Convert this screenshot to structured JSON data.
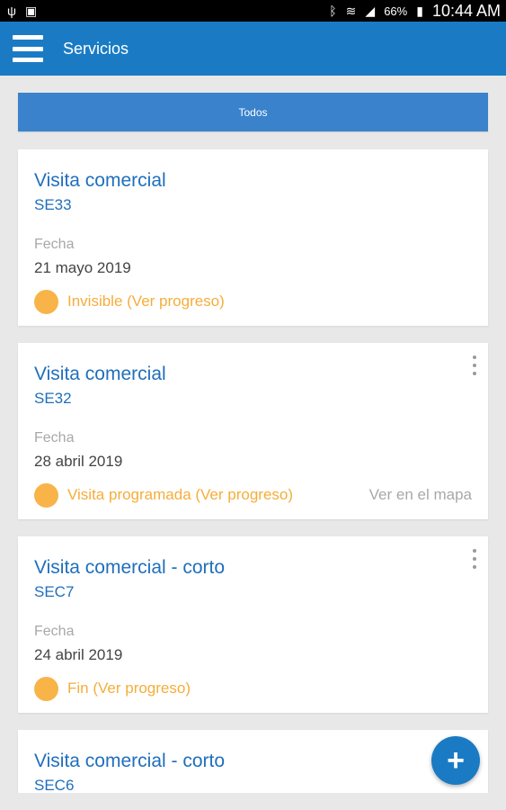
{
  "status_bar": {
    "icons": [
      "usb-icon",
      "no-sim-icon",
      "bluetooth-icon",
      "wifi-icon",
      "signal-icon",
      "battery-icon"
    ],
    "battery": "66%",
    "time": "10:44 AM"
  },
  "app_bar": {
    "title": "Servicios",
    "menu_icon": "menu-icon"
  },
  "filter": {
    "tab_label": "Todos",
    "color": "#3a82cc"
  },
  "cards": [
    {
      "title": "Visita comercial",
      "code": "SE33",
      "date_label": "Fecha",
      "date": "21 mayo 2019",
      "status": "Invisible (Ver progreso)",
      "map_link": "",
      "has_menu": false
    },
    {
      "title": "Visita comercial",
      "code": "SE32",
      "date_label": "Fecha",
      "date": "28 abril 2019",
      "status": "Visita programada (Ver progreso)",
      "map_link": "Ver en el mapa",
      "has_menu": true
    },
    {
      "title": "Visita comercial - corto",
      "code": "SEC7",
      "date_label": "Fecha",
      "date": "24 abril 2019",
      "status": "Fin (Ver progreso)",
      "map_link": "",
      "has_menu": true
    },
    {
      "title": "Visita comercial - corto",
      "code": "SEC6"
    }
  ],
  "fab": {
    "label": "+"
  },
  "colors": {
    "accent": "#1a7bc4",
    "status": "#f8b448",
    "title": "#1f6fbd"
  }
}
